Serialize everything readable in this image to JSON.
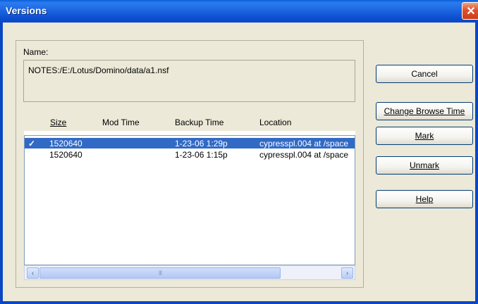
{
  "window": {
    "title": "Versions",
    "close_glyph": "✕"
  },
  "name_section": {
    "label": "Name:",
    "value": "NOTES:/E:/Lotus/Domino/data/a1.nsf"
  },
  "table": {
    "columns": [
      "Size",
      "Mod Time",
      "Backup Time",
      "Location"
    ],
    "rows": [
      {
        "checked": true,
        "check_glyph": "✓",
        "size": "1520640",
        "mod_time": "",
        "backup_time": "1-23-06  1:29p",
        "location": "cypresspl.004 at /space"
      },
      {
        "checked": false,
        "check_glyph": "",
        "size": "1520640",
        "mod_time": "",
        "backup_time": "1-23-06  1:15p",
        "location": "cypresspl.004 at /space"
      }
    ],
    "selected_row": 0
  },
  "scrollbar": {
    "left_glyph": "‹",
    "right_glyph": "›",
    "thumb_grip": "III"
  },
  "buttons": {
    "cancel": "Cancel",
    "change_browse_time": "Change Browse Time",
    "mark": "Mark",
    "unmark": "Unmark",
    "help": "Help"
  },
  "colors": {
    "title_bar": "#0a47c4",
    "selection": "#316ac5",
    "dialog_face": "#ece9d8"
  }
}
